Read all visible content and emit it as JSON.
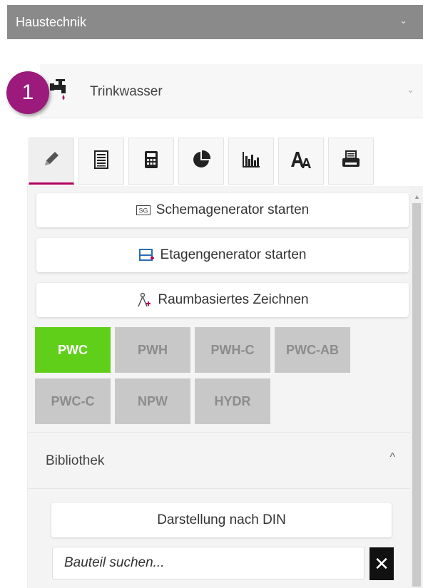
{
  "header": {
    "title": "Haustechnik",
    "chevron": "⌄"
  },
  "accordion": {
    "title": "Trinkwasser",
    "icon": "water-tap-icon",
    "chevron": "⌄",
    "badge": "1"
  },
  "tabs": [
    {
      "icon": "pencil-icon",
      "active": true
    },
    {
      "icon": "list-icon",
      "active": false
    },
    {
      "icon": "calculator-icon",
      "active": false
    },
    {
      "icon": "pie-chart-icon",
      "active": false
    },
    {
      "icon": "bar-chart-icon",
      "active": false
    },
    {
      "icon": "text-style-icon",
      "active": false
    },
    {
      "icon": "printer-icon",
      "active": false
    }
  ],
  "buttons": {
    "schema": {
      "label": "Schemagenerator starten",
      "icon": "sg-icon"
    },
    "etage": {
      "label": "Etagengenerator starten",
      "icon": "floor-add-icon"
    },
    "raum": {
      "label": "Raumbasiertes Zeichnen",
      "icon": "room-draw-icon"
    }
  },
  "chips": [
    {
      "label": "PWC",
      "active": true
    },
    {
      "label": "PWH",
      "active": false
    },
    {
      "label": "PWH-C",
      "active": false
    },
    {
      "label": "PWC-AB",
      "active": false
    },
    {
      "label": "PWC-C",
      "active": false
    },
    {
      "label": "NPW",
      "active": false
    },
    {
      "label": "HYDR",
      "active": false
    }
  ],
  "library": {
    "title": "Bibliothek",
    "chevron": "^",
    "din_button": "Darstellung nach DIN",
    "search_placeholder": "Bauteil suchen...",
    "clear": "✕"
  },
  "colors": {
    "header": "#8a8a8a",
    "badge": "#9b1a7c",
    "active_chip": "#5fcf1a",
    "tab_accent": "#b3005e"
  }
}
